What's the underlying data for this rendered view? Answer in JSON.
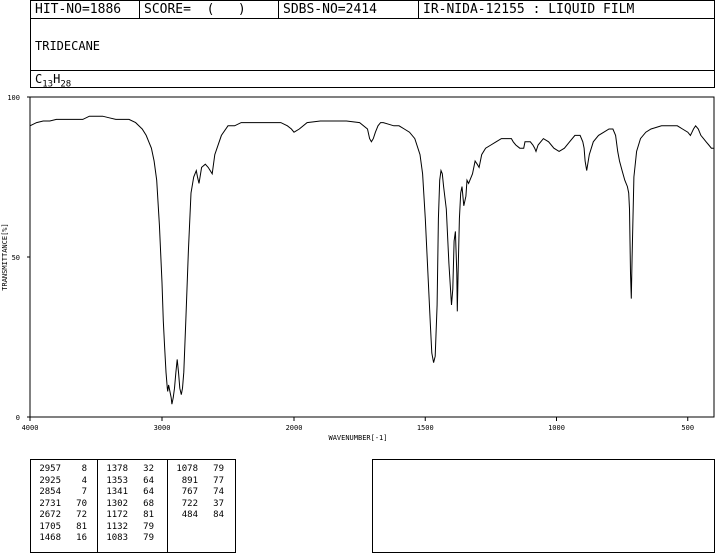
{
  "header": {
    "hit_no": "HIT-NO=1886",
    "score": "SCORE=  (   )",
    "sdbs_no": "SDBS-NO=2414",
    "ir_nida": "IR-NIDA-12155 : LIQUID FILM"
  },
  "compound": {
    "name": "TRIDECANE",
    "formula_c": "13",
    "formula_h": "28"
  },
  "chart_data": {
    "type": "line",
    "xlabel": "WAVENUMBER[-1]",
    "ylabel": "TRANSMITTANCE[%]",
    "xlim": [
      4000,
      400
    ],
    "ylim": [
      0,
      100
    ],
    "xticks": [
      "4000",
      "3000",
      "2000",
      "1500",
      "1000",
      "500"
    ],
    "yticks": [
      "0",
      "50",
      "100"
    ],
    "grid": false,
    "x": [
      4000,
      3950,
      3900,
      3850,
      3800,
      3750,
      3700,
      3650,
      3600,
      3550,
      3500,
      3450,
      3400,
      3350,
      3300,
      3250,
      3200,
      3150,
      3120,
      3100,
      3080,
      3060,
      3040,
      3020,
      3000,
      2990,
      2980,
      2970,
      2960,
      2957,
      2950,
      2940,
      2930,
      2925,
      2915,
      2905,
      2895,
      2885,
      2875,
      2865,
      2854,
      2845,
      2835,
      2820,
      2800,
      2780,
      2760,
      2740,
      2731,
      2720,
      2700,
      2672,
      2650,
      2620,
      2600,
      2550,
      2500,
      2450,
      2400,
      2350,
      2300,
      2250,
      2200,
      2150,
      2100,
      2050,
      2020,
      2000,
      1980,
      1950,
      1900,
      1850,
      1800,
      1750,
      1720,
      1712,
      1705,
      1698,
      1690,
      1680,
      1670,
      1660,
      1640,
      1620,
      1600,
      1580,
      1560,
      1540,
      1520,
      1510,
      1500,
      1490,
      1480,
      1475,
      1468,
      1462,
      1455,
      1450,
      1445,
      1440,
      1435,
      1430,
      1420,
      1410,
      1400,
      1395,
      1390,
      1385,
      1380,
      1378,
      1375,
      1370,
      1365,
      1360,
      1353,
      1345,
      1341,
      1335,
      1320,
      1310,
      1302,
      1295,
      1285,
      1270,
      1250,
      1230,
      1210,
      1190,
      1180,
      1172,
      1165,
      1155,
      1140,
      1132,
      1125,
      1120,
      1110,
      1100,
      1090,
      1083,
      1078,
      1070,
      1050,
      1030,
      1010,
      990,
      970,
      950,
      930,
      910,
      900,
      895,
      891,
      885,
      875,
      860,
      840,
      820,
      800,
      785,
      775,
      767,
      760,
      750,
      740,
      730,
      725,
      722,
      718,
      715,
      712,
      705,
      695,
      680,
      660,
      640,
      620,
      600,
      580,
      560,
      540,
      520,
      500,
      490,
      484,
      478,
      470,
      460,
      450,
      440,
      430,
      420,
      410,
      400
    ],
    "y": [
      91,
      92,
      92.5,
      92.5,
      93,
      93,
      93,
      93,
      93,
      94,
      94,
      94,
      93.5,
      93,
      93,
      93,
      92,
      90,
      88,
      86,
      84,
      80,
      74,
      60,
      42,
      30,
      22,
      14,
      9,
      8,
      10,
      8,
      6,
      4,
      6,
      9,
      14,
      18,
      14,
      9,
      7,
      9,
      14,
      30,
      52,
      70,
      75,
      77,
      75,
      73,
      78,
      79,
      78,
      76,
      82,
      88,
      91,
      91,
      92,
      92,
      92,
      92,
      92,
      92,
      92,
      91,
      90,
      89,
      90,
      92,
      92.5,
      92.5,
      92.5,
      92,
      90,
      87,
      86,
      87,
      89,
      91,
      92,
      92,
      91.5,
      91,
      91,
      90,
      89,
      87,
      82,
      76,
      62,
      45,
      28,
      20,
      17,
      19,
      35,
      62,
      74,
      77,
      76,
      72,
      65,
      48,
      35,
      40,
      55,
      58,
      45,
      33,
      45,
      62,
      70,
      72,
      66,
      69,
      74,
      73,
      76,
      80,
      79,
      78,
      82,
      84,
      85,
      86,
      87,
      87,
      87,
      87,
      86,
      85,
      84,
      84,
      84,
      86,
      86,
      86,
      85,
      84,
      83,
      85,
      87,
      86,
      84,
      83,
      84,
      86,
      88,
      88,
      86,
      84,
      80,
      77,
      82,
      86,
      88,
      89,
      90,
      90,
      88,
      83,
      80,
      77,
      74,
      72,
      70,
      65,
      45,
      37,
      50,
      75,
      83,
      87,
      89,
      90,
      90.5,
      91,
      91,
      91,
      91,
      90,
      89,
      88,
      89,
      90,
      91,
      90,
      88,
      87,
      86,
      85,
      84,
      84,
      84
    ]
  },
  "peak_table": {
    "col1": [
      [
        "2957",
        "8"
      ],
      [
        "2925",
        "4"
      ],
      [
        "2854",
        "7"
      ],
      [
        "2731",
        "70"
      ],
      [
        "2672",
        "72"
      ],
      [
        "1705",
        "81"
      ],
      [
        "1468",
        "16"
      ]
    ],
    "col2": [
      [
        "1378",
        "32"
      ],
      [
        "1353",
        "64"
      ],
      [
        "1341",
        "64"
      ],
      [
        "1302",
        "68"
      ],
      [
        "1172",
        "81"
      ],
      [
        "1132",
        "79"
      ],
      [
        "1083",
        "79"
      ]
    ],
    "col3": [
      [
        "1078",
        "79"
      ],
      [
        "891",
        "77"
      ],
      [
        "767",
        "74"
      ],
      [
        "722",
        "37"
      ],
      [
        "484",
        "84"
      ]
    ]
  }
}
